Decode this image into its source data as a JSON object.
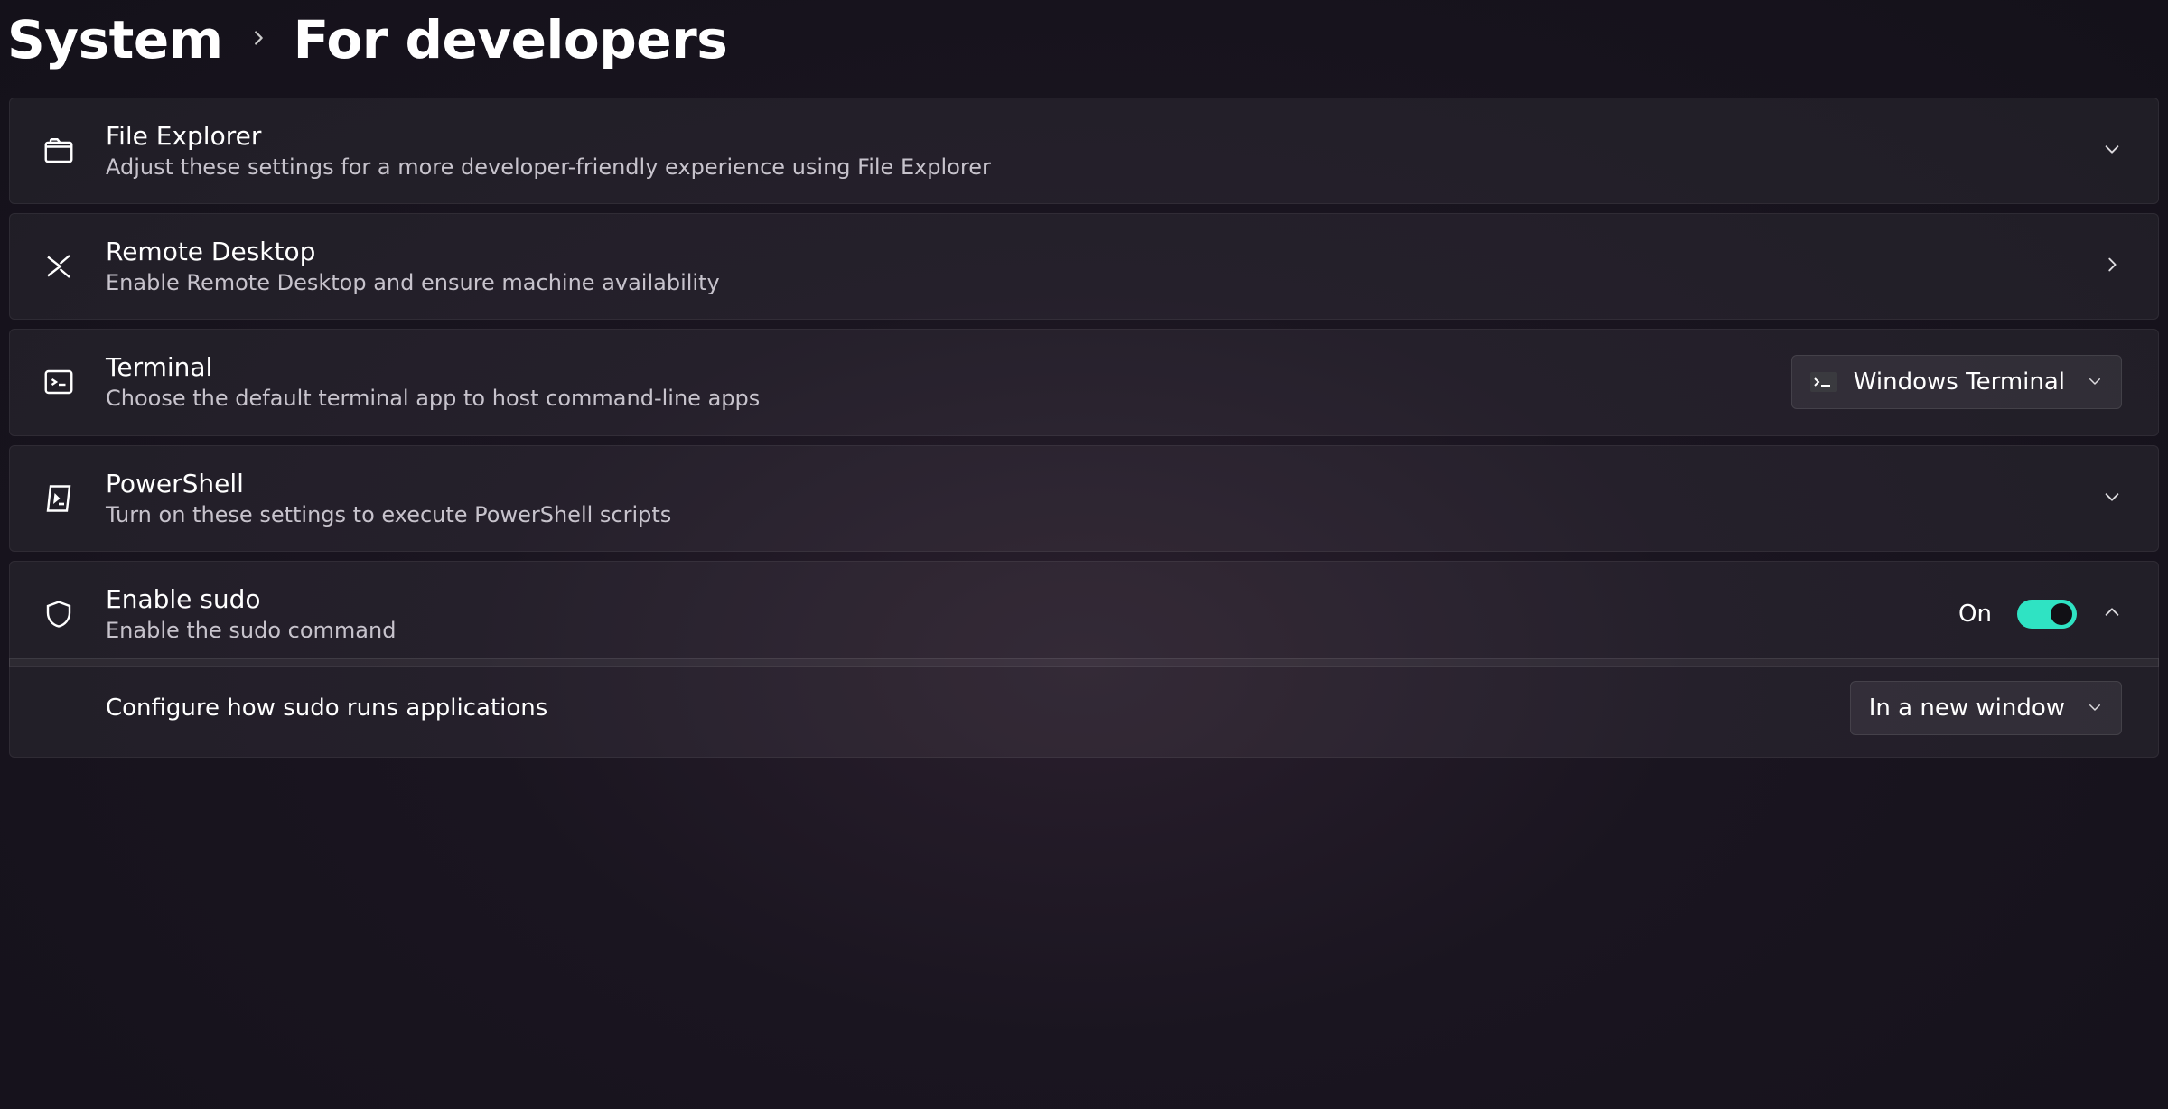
{
  "colors": {
    "toggle_on": "#2fe3c3"
  },
  "breadcrumb": {
    "parent": "System",
    "current": "For developers"
  },
  "settings": {
    "file_explorer": {
      "title": "File Explorer",
      "desc": "Adjust these settings for a more developer-friendly experience using File Explorer"
    },
    "remote_desktop": {
      "title": "Remote Desktop",
      "desc": "Enable Remote Desktop and ensure machine availability"
    },
    "terminal": {
      "title": "Terminal",
      "desc": "Choose the default terminal app to host command-line apps",
      "selected": "Windows Terminal"
    },
    "powershell": {
      "title": "PowerShell",
      "desc": "Turn on these settings to execute PowerShell scripts"
    },
    "sudo": {
      "title": "Enable sudo",
      "desc": "Enable the sudo command",
      "state_label": "On",
      "enabled": true,
      "config": {
        "title": "Configure how sudo runs applications",
        "selected": "In a new window"
      }
    }
  }
}
